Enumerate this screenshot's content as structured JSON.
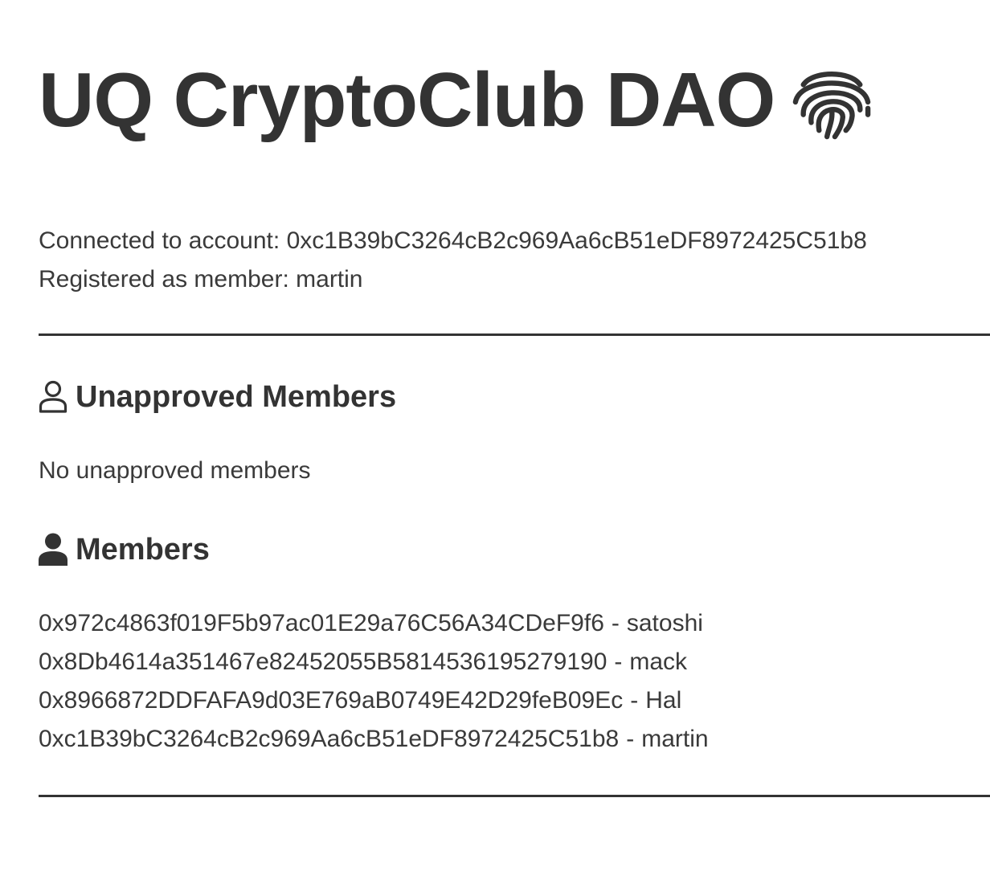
{
  "header": {
    "title": "UQ CryptoClub DAO",
    "title_icon": "fingerprint-icon"
  },
  "account": {
    "connected_label": "Connected to account:",
    "connected_address": "0xc1B39bC3264cB2c969Aa6cB51eDF8972425C51b8",
    "registered_label": "Registered as member:",
    "registered_name": "martin"
  },
  "unapproved": {
    "icon": "user-outline-icon",
    "heading": "Unapproved Members",
    "empty_text": "No unapproved members"
  },
  "members": {
    "icon": "user-filled-icon",
    "heading": "Members",
    "separator": "-",
    "list": [
      {
        "address": "0x972c4863f019F5b97ac01E29a76C56A34CDeF9f6",
        "name": "satoshi"
      },
      {
        "address": "0x8Db4614a351467e82452055B5814536195279190",
        "name": "mack"
      },
      {
        "address": "0x8966872DDFAFA9d03E769aB0749E42D29feB09Ec",
        "name": "Hal"
      },
      {
        "address": "0xc1B39bC3264cB2c969Aa6cB51eDF8972425C51b8",
        "name": "martin"
      }
    ]
  },
  "colors": {
    "text": "#333333",
    "background": "#ffffff",
    "divider": "#333333"
  }
}
